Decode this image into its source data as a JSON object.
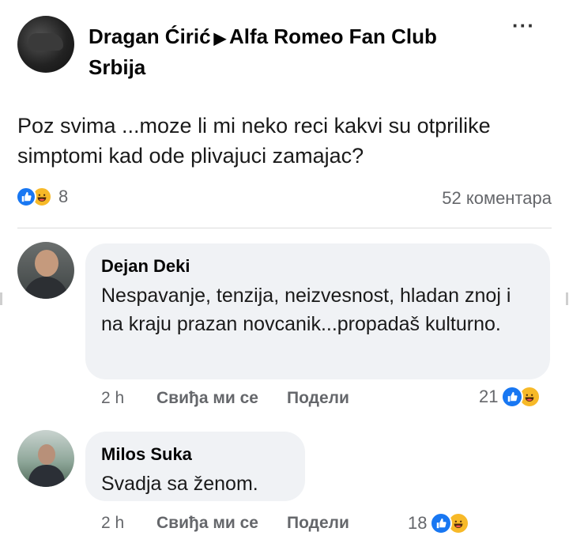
{
  "post": {
    "author": "Dragan Ćirić",
    "separator_icon": "triangle-right-icon",
    "group": "Alfa Romeo Fan Club Srbija",
    "more_label": "···",
    "text": "Poz svima ...moze li mi neko reci kakvi su otprilike simptomi kad ode plivajuci zamajac?",
    "reactions": {
      "icons": [
        "like-icon",
        "laugh-icon"
      ],
      "count": "8"
    },
    "comments_count": "52 коментара"
  },
  "comments": [
    {
      "author": "Dejan Deki",
      "text": "Nespavanje, tenzija, neizvesnost, hladan znoj i na kraju prazan novcanik...propadaš kulturno.",
      "time": "2 h",
      "like_label": "Свиђа ми се",
      "share_label": "Подели",
      "reaction_count": "21"
    },
    {
      "author": "Milos Suka",
      "text": "Svadja sa ženom.",
      "time": "2 h",
      "like_label": "Свиђа ми се",
      "share_label": "Подели",
      "reaction_count": "18"
    }
  ],
  "colors": {
    "like": "#1877f2",
    "laugh": "#f7b928",
    "bubble": "#f0f2f5",
    "meta_text": "#65676b"
  }
}
